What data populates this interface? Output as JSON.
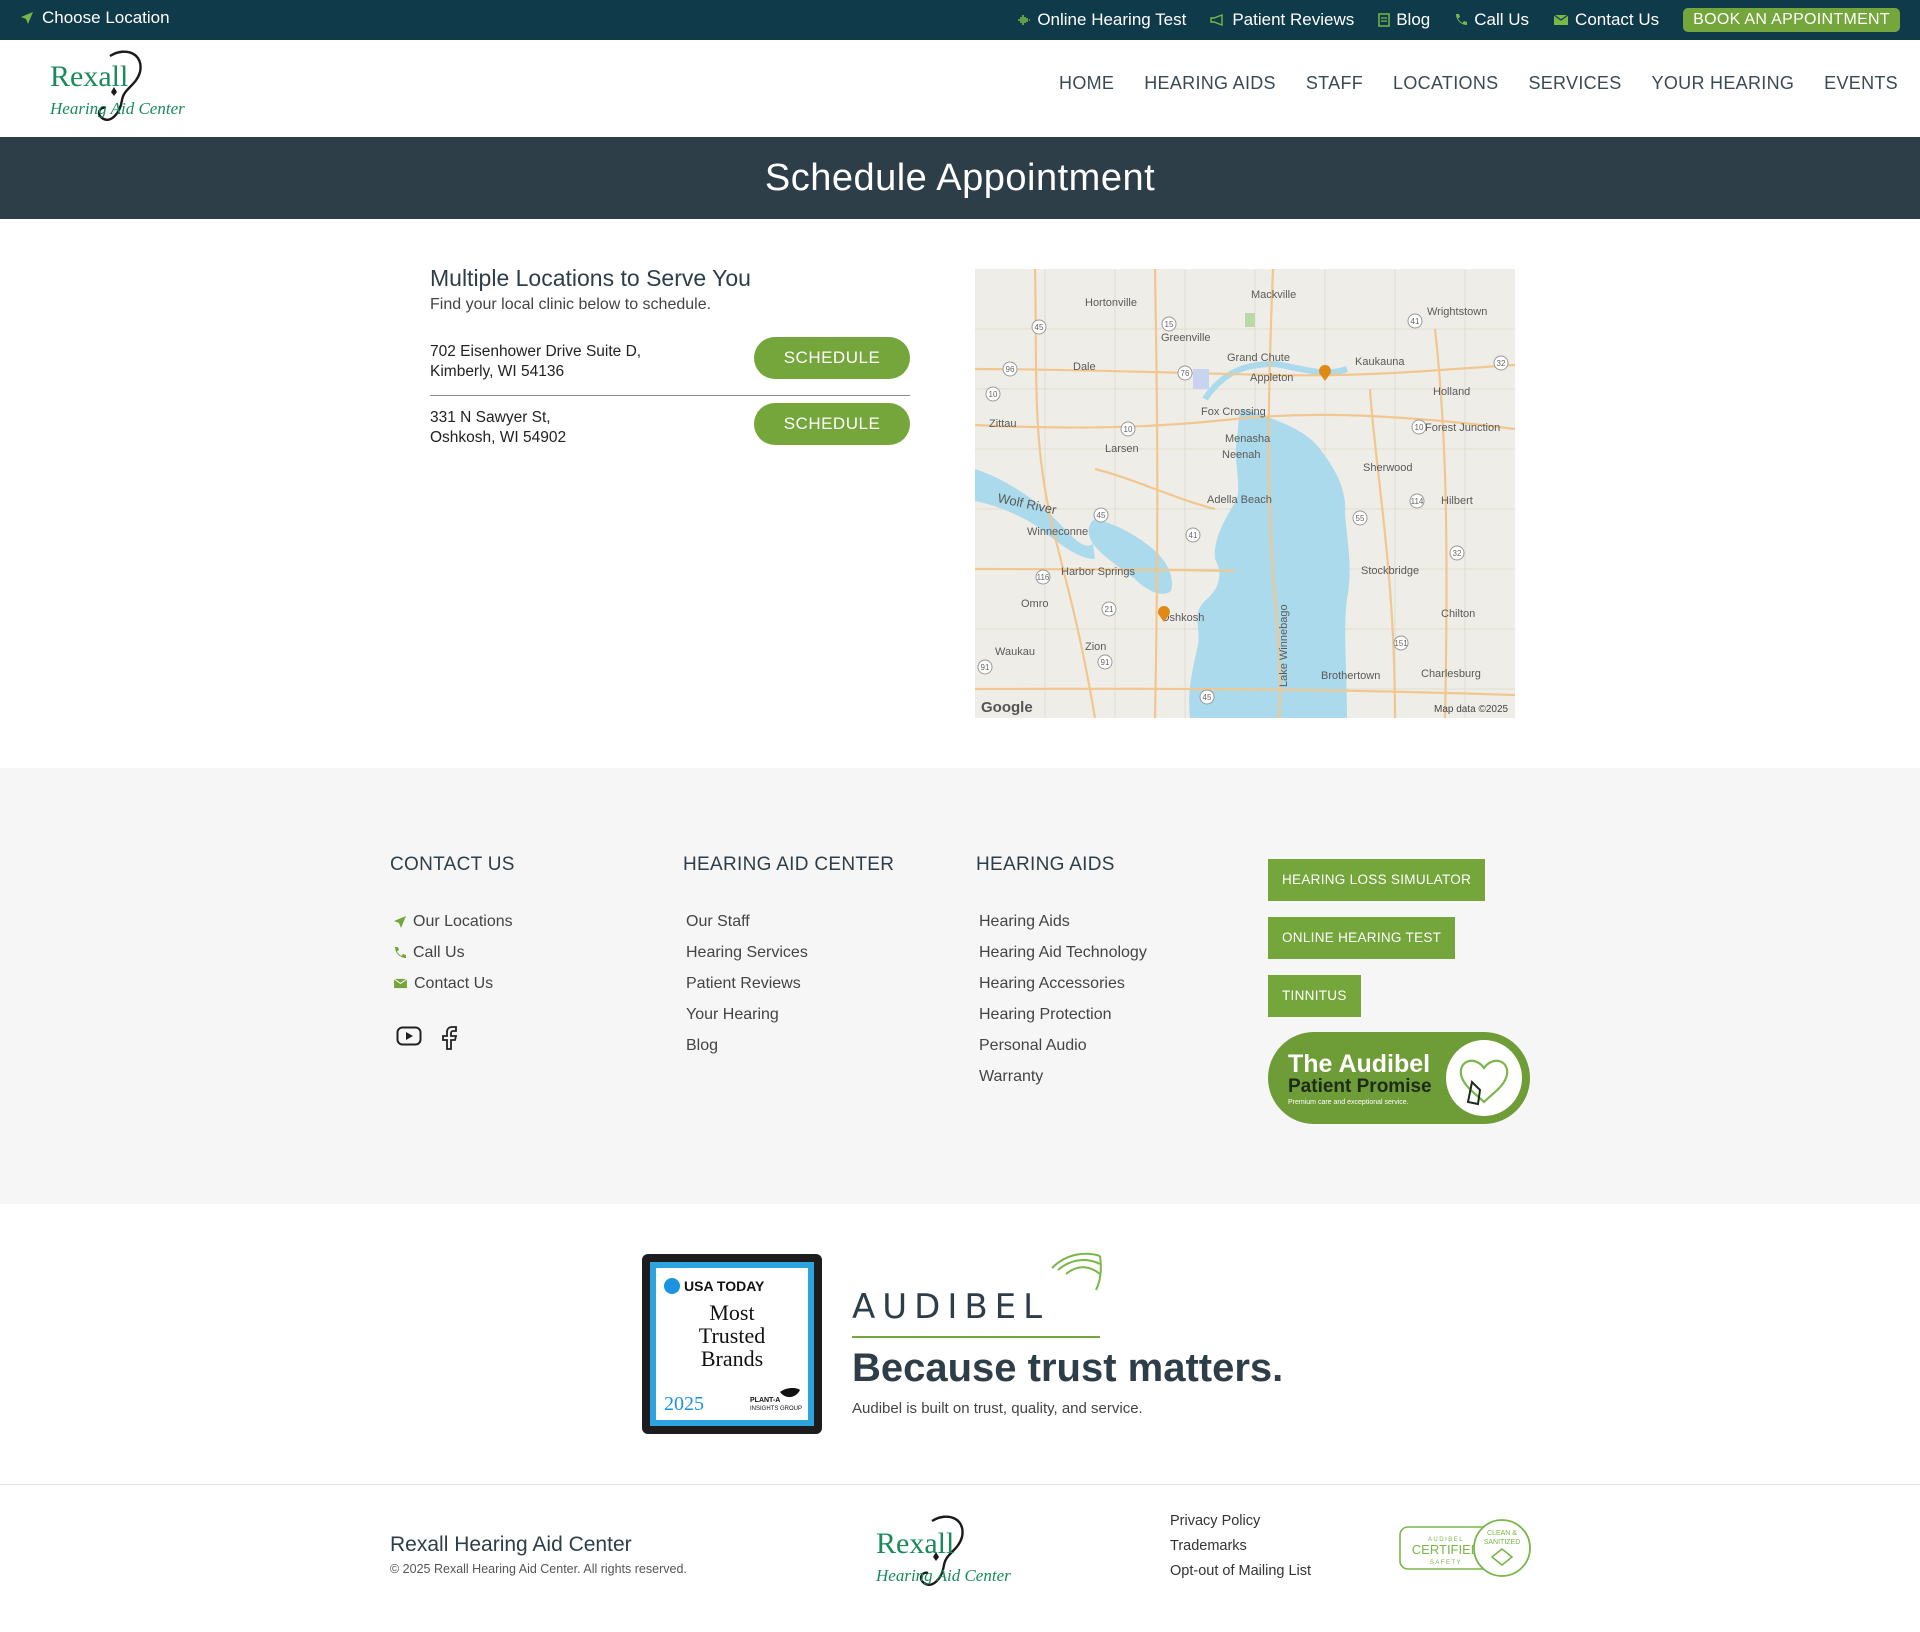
{
  "topbar": {
    "choose_location": "Choose Location",
    "links": [
      {
        "label": "Online Hearing Test",
        "icon": "waveform-icon"
      },
      {
        "label": "Patient Reviews",
        "icon": "megaphone-icon"
      },
      {
        "label": "Blog",
        "icon": "document-icon"
      },
      {
        "label": "Call Us",
        "icon": "phone-icon"
      },
      {
        "label": "Contact Us",
        "icon": "envelope-icon"
      }
    ],
    "book_label": "BOOK AN APPOINTMENT"
  },
  "brand": {
    "logo_line1": "Rexall",
    "logo_line2": "Hearing Aid Center",
    "accent": "#74a63b",
    "dark": "#0f3a4a",
    "logo_green": "#1a8a5a"
  },
  "nav": [
    "HOME",
    "HEARING AIDS",
    "STAFF",
    "LOCATIONS",
    "SERVICES",
    "YOUR HEARING",
    "EVENTS"
  ],
  "page_title": "Schedule Appointment",
  "locations": {
    "heading": "Multiple Locations to Serve You",
    "subheading": "Find your local clinic below to schedule.",
    "items": [
      {
        "line1": "702 Eisenhower Drive Suite D,",
        "line2": "Kimberly, WI 54136",
        "button": "SCHEDULE"
      },
      {
        "line1": "331 N Sawyer St,",
        "line2": "Oshkosh, WI 54902",
        "button": "SCHEDULE"
      }
    ]
  },
  "map": {
    "labels": [
      "Hortonville",
      "Mackville",
      "Wrightstown",
      "Greenville",
      "Dale",
      "Grand Chute",
      "Kaukauna",
      "Appleton",
      "Holland",
      "Zittau",
      "Fox Crossing",
      "Forest Junction",
      "Larsen",
      "Menasha",
      "Neenah",
      "Sherwood",
      "Wolf River",
      "Adella Beach",
      "Hilbert",
      "Winneconne",
      "Harbor Springs",
      "Stockbridge",
      "Omro",
      "Oshkosh",
      "Chilton",
      "Zion",
      "Waukau",
      "Lake Winnebago",
      "Brothertown",
      "Charlesburg"
    ],
    "road_shields": [
      "45",
      "15",
      "41",
      "32",
      "96",
      "76",
      "10",
      "10",
      "10",
      "114",
      "45",
      "41",
      "55",
      "32",
      "116",
      "21",
      "151",
      "91",
      "91",
      "45"
    ],
    "attribution_logo": "Google",
    "attribution": "Map data ©2025"
  },
  "footer": {
    "contact": {
      "heading": "CONTACT US",
      "items": [
        {
          "label": "Our Locations",
          "icon": "location-arrow-icon"
        },
        {
          "label": "Call Us",
          "icon": "phone-icon"
        },
        {
          "label": "Contact Us",
          "icon": "envelope-icon"
        }
      ]
    },
    "center": {
      "heading": "HEARING AID CENTER",
      "items": [
        "Our Staff",
        "Hearing Services",
        "Patient Reviews",
        "Your Hearing",
        "Blog"
      ]
    },
    "aids": {
      "heading": "HEARING AIDS",
      "items": [
        "Hearing Aids",
        "Hearing Aid Technology",
        "Hearing Accessories",
        "Hearing Protection",
        "Personal Audio",
        "Warranty"
      ]
    },
    "buttons": [
      "HEARING LOSS SIMULATOR",
      "ONLINE HEARING TEST",
      "TINNITUS"
    ],
    "promise": {
      "line1": "The Audibel",
      "line2": "Patient Promise",
      "line3": "Premium care and exceptional service."
    }
  },
  "trust": {
    "badge": {
      "brand": "USA TODAY",
      "line1": "Most",
      "line2": "Trusted",
      "line3": "Brands",
      "year": "2025",
      "sponsor1": "PLANT-A",
      "sponsor2": "INSIGHTS GROUP"
    },
    "audibel": "AUDIBEL",
    "heading": "Because trust matters.",
    "text": "Audibel is built on trust, quality, and service."
  },
  "bottom": {
    "name": "Rexall Hearing Aid Center",
    "copyright": "© 2025 Rexall Hearing Aid Center. All rights reserved.",
    "links": [
      "Privacy Policy",
      "Trademarks",
      "Opt-out of Mailing List"
    ],
    "cert": {
      "top": "AUDIBEL",
      "main": "CERTIFIED",
      "bottom": "SAFETY",
      "badge1": "CLEAN &",
      "badge2": "SANITIZED"
    }
  }
}
